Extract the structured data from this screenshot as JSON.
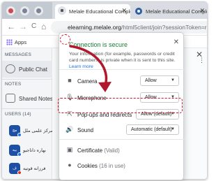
{
  "browser": {
    "tabs": [
      {
        "title": "Melale Educational Comple",
        "active": true
      },
      {
        "title": "Melale Educational Comple",
        "active": false
      }
    ],
    "url_host": "elearning.melale.org",
    "url_path": "/html5client/join?sessionToken=rkytk",
    "nav": {
      "back": "←",
      "forward": "→",
      "reload": "C",
      "home": "⌂"
    },
    "bookmarks_apps_label": "Apps"
  },
  "sidebar": {
    "messages_title": "MESSAGES",
    "public_chat_label": "Public Chat",
    "notes_title": "NOTES",
    "shared_notes_label": "Shared Notes",
    "users_title": "USERS (14)",
    "users": [
      {
        "avatar": "مج",
        "name": "مرکز علمی ملل",
        "badge_color": "#1a73e8"
      },
      {
        "avatar": "بیه",
        "name": "بهاره داناجیو",
        "badge_color": "#1a73e8"
      },
      {
        "avatar": "ف",
        "name": "فرزانه قوتیه",
        "badge_color": "#d93025"
      }
    ]
  },
  "popup": {
    "title": "Connection is secure",
    "close": "✕",
    "description": "Your information (for example, passwords or credit card numbers) is private when it is sent to this site.",
    "learn_more": "Learn more",
    "permissions": [
      {
        "icon": "camera-icon",
        "label": "Camera",
        "value": "Allow"
      },
      {
        "icon": "microphone-icon",
        "label": "Microphone",
        "value": "Allow"
      },
      {
        "icon": "popup-icon",
        "label": "Pop-ups and redirects",
        "value": "Allow (default)"
      },
      {
        "icon": "sound-icon",
        "label": "Sound",
        "value": "Automatic (default)"
      }
    ],
    "certificate_label": "Certificate",
    "certificate_status": "(Valid)",
    "cookies_label": "Cookies",
    "cookies_status": "(16 in use)"
  },
  "colors": {
    "secure_green": "#188038",
    "highlight_red": "#d1152b",
    "arrow_red": "#b0182b",
    "link_blue": "#1a73e8"
  }
}
